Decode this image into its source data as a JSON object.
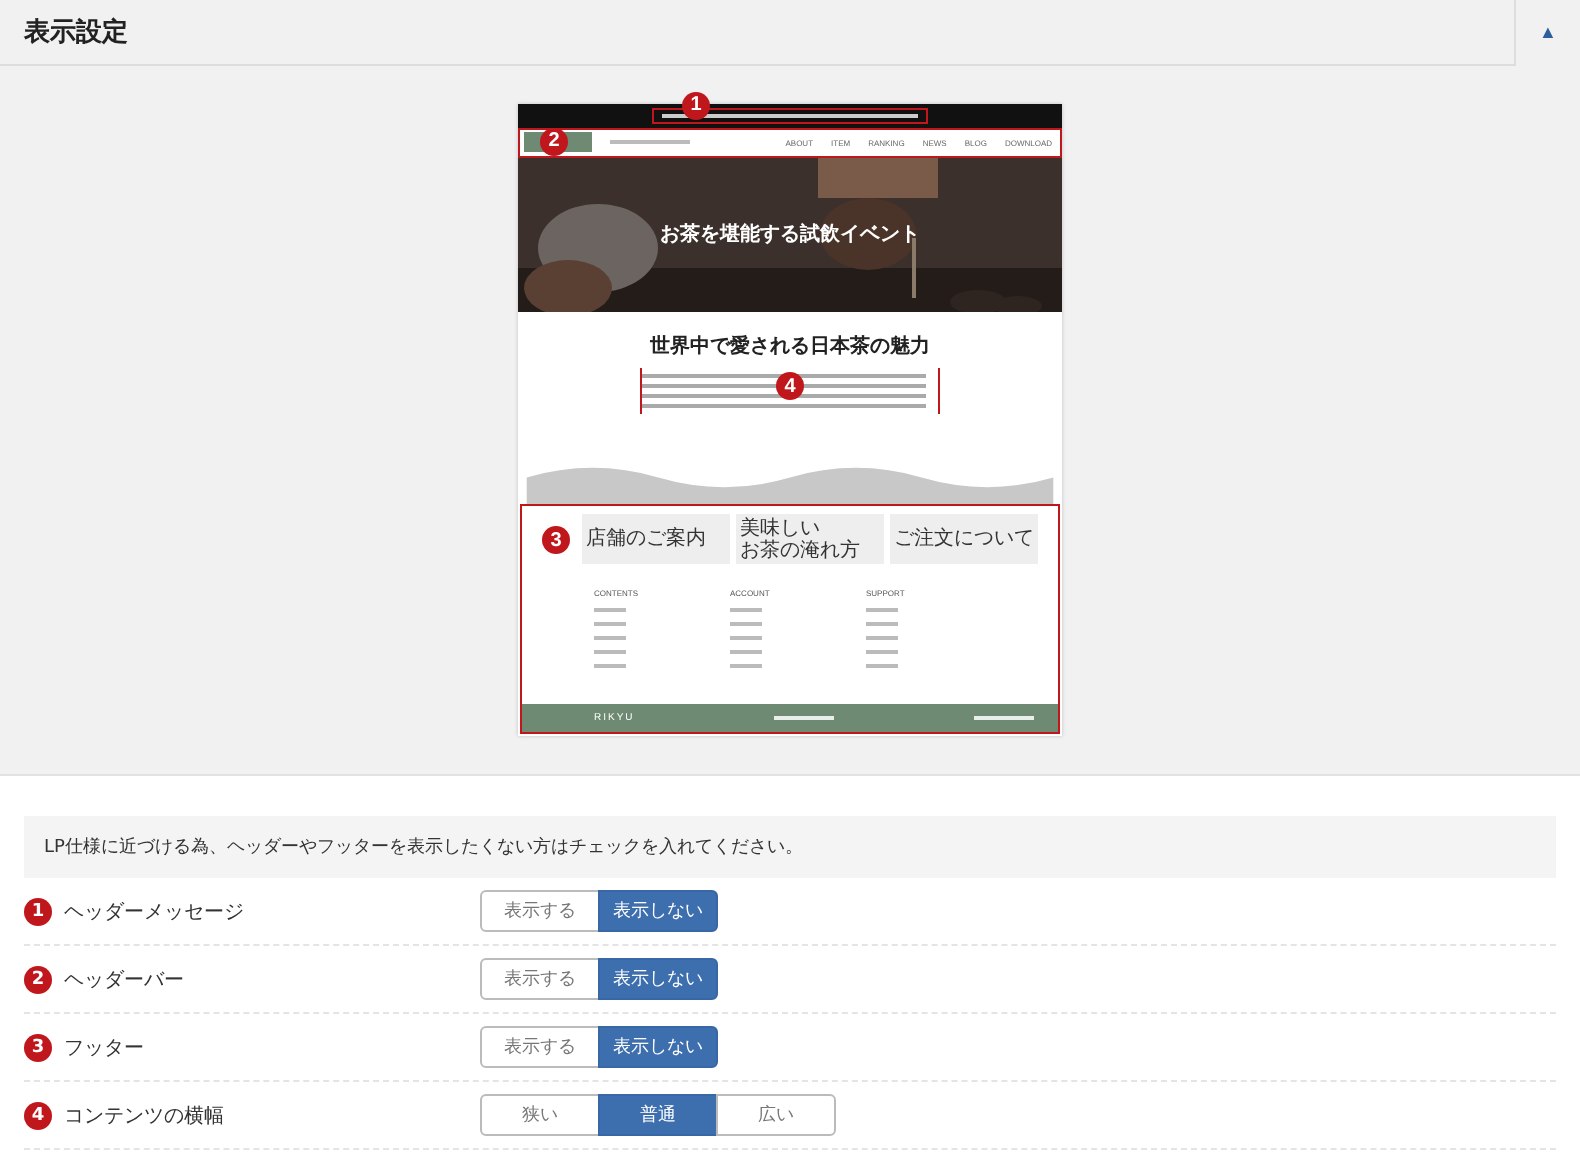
{
  "panel": {
    "title": "表示設定",
    "toggle": "▲"
  },
  "preview": {
    "markers": [
      "1",
      "2",
      "3",
      "4"
    ],
    "nav_items": [
      "ABOUT",
      "ITEM",
      "RANKING",
      "NEWS",
      "BLOG",
      "DOWNLOAD"
    ],
    "hero_title": "お茶を堪能する試飲イベント",
    "section_title": "世界中で愛される日本茶の魅力",
    "footer_cards": [
      [
        "店舗のご案内"
      ],
      [
        "美味しい",
        "お茶の淹れ方"
      ],
      [
        "ご注文について"
      ]
    ],
    "footer_columns": [
      "CONTENTS",
      "ACCOUNT",
      "SUPPORT"
    ],
    "brand": "RIKYU"
  },
  "notice": "LP仕様に近づける為、ヘッダーやフッターを表示したくない方はチェックを入れてください。",
  "settings": [
    {
      "number": "1",
      "label": "ヘッダーメッセージ",
      "options": [
        {
          "label": "表示する",
          "selected": false
        },
        {
          "label": "表示しない",
          "selected": true
        }
      ]
    },
    {
      "number": "2",
      "label": "ヘッダーバー",
      "options": [
        {
          "label": "表示する",
          "selected": false
        },
        {
          "label": "表示しない",
          "selected": true
        }
      ]
    },
    {
      "number": "3",
      "label": "フッター",
      "options": [
        {
          "label": "表示する",
          "selected": false
        },
        {
          "label": "表示しない",
          "selected": true
        }
      ]
    },
    {
      "number": "4",
      "label": "コンテンツの横幅",
      "options": [
        {
          "label": "狭い",
          "selected": false
        },
        {
          "label": "普通",
          "selected": true
        },
        {
          "label": "広い",
          "selected": false
        }
      ]
    }
  ]
}
